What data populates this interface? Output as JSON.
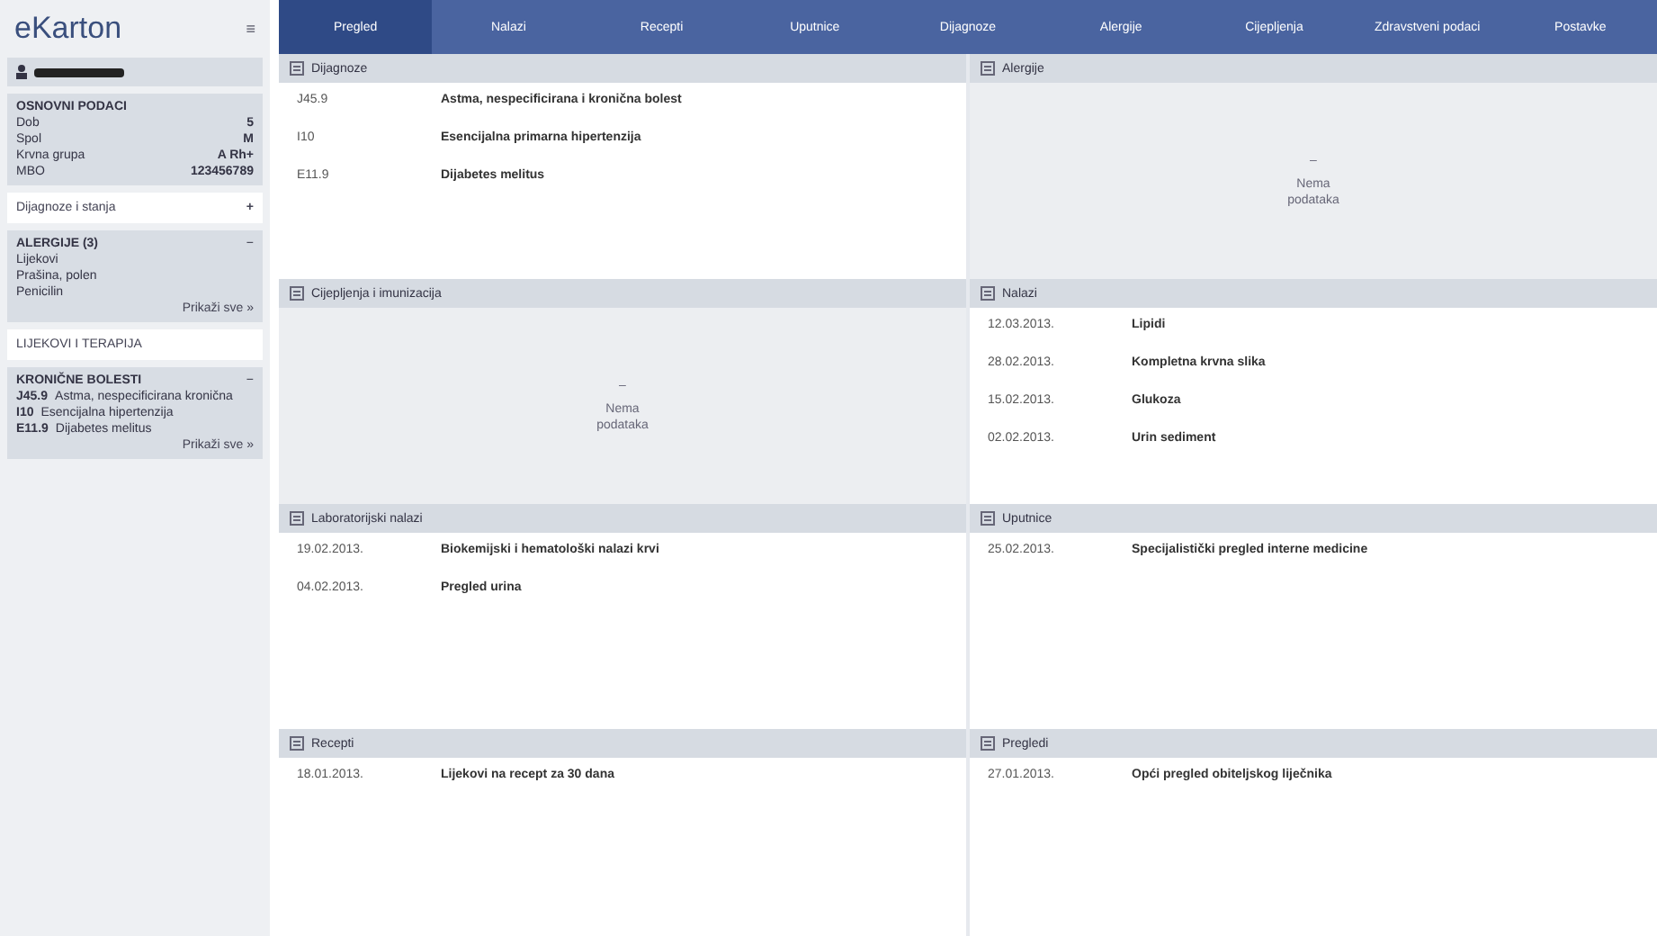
{
  "sidebar": {
    "logo": "eKarton",
    "menu_icon": "≡",
    "basic": {
      "title": "OSNOVNI PODACI",
      "rows": [
        {
          "label": "Dob",
          "value": "5"
        },
        {
          "label": "Spol",
          "value": "M"
        },
        {
          "label": "Krvna grupa",
          "value": "A Rh+"
        },
        {
          "label": "MBO",
          "value": "123456789"
        }
      ]
    },
    "sections": [
      {
        "title": "Dijagnoze i stanja",
        "action": "+",
        "card": {
          "title": "ALERGIJE (3)",
          "toggle": "−",
          "items": [
            {
              "text": "Lijekovi"
            },
            {
              "text": "Prašina, polen"
            },
            {
              "text": "Penicilin"
            }
          ],
          "more": "Prikaži sve »"
        }
      },
      {
        "title": "LIJEKOVI I TERAPIJA",
        "card": {
          "title": "KRONIČNE BOLESTI",
          "toggle": "−",
          "items": [
            {
              "code": "J45.9",
              "text": "Astma, nespecificirana kronična"
            },
            {
              "code": "I10",
              "text": "Esencijalna hipertenzija"
            },
            {
              "code": "E11.9",
              "text": "Dijabetes melitus"
            }
          ],
          "more": "Prikaži sve »"
        }
      }
    ]
  },
  "tabs": [
    {
      "label": "Pregled",
      "selected": true
    },
    {
      "label": "Nalazi",
      "selected": false
    },
    {
      "label": "Recepti",
      "selected": false
    },
    {
      "label": "Uputnice",
      "selected": false
    },
    {
      "label": "Dijagnoze",
      "selected": false
    },
    {
      "label": "Alergije",
      "selected": false
    },
    {
      "label": "Cijepljenja",
      "selected": false
    },
    {
      "label": "Zdravstveni podaci",
      "selected": false
    },
    {
      "label": "Postavke",
      "selected": false
    }
  ],
  "panels": [
    {
      "title": "Dijagnoze",
      "rows": [
        {
          "c1": "J45.9",
          "c2": "Astma, nespecificirana i kronična bolest"
        },
        {
          "c1": "I10",
          "c2": "Esencijalna primarna hipertenzija"
        },
        {
          "c1": "E11.9",
          "c2": "Dijabetes melitus"
        }
      ]
    },
    {
      "title": "Alergije",
      "empty_icon": "–",
      "empty_text": [
        "Nema",
        "podataka"
      ]
    },
    {
      "title": "Cijepljenja i imunizacija",
      "empty_icon": "–",
      "empty_text": [
        "Nema",
        "podataka"
      ]
    },
    {
      "title": "Nalazi",
      "rows": [
        {
          "c1": "12.03.2013.",
          "c2": "Lipidi"
        },
        {
          "c1": "28.02.2013.",
          "c2": "Kompletna krvna slika"
        },
        {
          "c1": "15.02.2013.",
          "c2": "Glukoza"
        },
        {
          "c1": "02.02.2013.",
          "c2": "Urin sediment"
        }
      ]
    },
    {
      "title": "Laboratorijski nalazi",
      "rows": [
        {
          "c1": "19.02.2013.",
          "c2": "Biokemijski i hematološki nalazi krvi"
        },
        {
          "c1": "04.02.2013.",
          "c2": "Pregled urina"
        }
      ]
    },
    {
      "title": "Uputnice",
      "rows": [
        {
          "c1": "25.02.2013.",
          "c2": "Specijalistički pregled interne medicine"
        }
      ]
    },
    {
      "title": "Recepti",
      "rows": [
        {
          "c1": "18.01.2013.",
          "c2": "Lijekovi na recept za 30 dana"
        }
      ]
    },
    {
      "title": "Pregledi",
      "rows": [
        {
          "c1": "27.01.2013.",
          "c2": "Opći pregled obiteljskog liječnika"
        }
      ]
    }
  ]
}
